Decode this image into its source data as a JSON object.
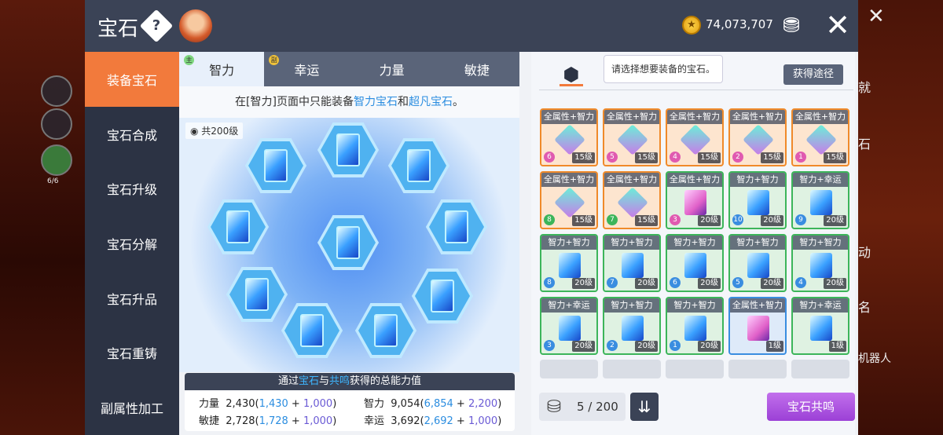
{
  "header": {
    "title": "宝石",
    "help_glyph": "?",
    "currency": "74,073,707"
  },
  "sidebar": {
    "items": [
      "装备宝石",
      "宝石合成",
      "宝石升级",
      "宝石分解",
      "宝石升品",
      "宝石重铸",
      "副属性加工"
    ],
    "active": 0
  },
  "tabs": [
    {
      "label": "智力",
      "badge": "主"
    },
    {
      "label": "幸运",
      "badge": "副"
    },
    {
      "label": "力量",
      "badge": ""
    },
    {
      "label": "敏捷",
      "badge": ""
    }
  ],
  "notice": {
    "pre": "在[智力]页面中只能装备",
    "hl1": "智力宝石",
    "mid": "和",
    "hl2": "超凡宝石",
    "post": "。"
  },
  "stage": {
    "level_total": "共200级"
  },
  "stats": {
    "head_pre": "通过",
    "head_hl1": "宝石",
    "head_mid": "与",
    "head_hl2": "共鸣",
    "head_post": "获得的总能力值",
    "rows": [
      {
        "name": "力量",
        "total": "2,430",
        "a": "1,430",
        "b": "1,000"
      },
      {
        "name": "敏捷",
        "total": "2,728",
        "a": "1,728",
        "b": "1,000"
      },
      {
        "name": "智力",
        "total": "9,054",
        "a": "6,854",
        "b": "2,200"
      },
      {
        "name": "幸运",
        "total": "3,692",
        "a": "2,692",
        "b": "1,000"
      }
    ]
  },
  "right": {
    "tooltip": "请选择想要装备的宝石。",
    "source_button": "获得途径",
    "bag_count": "5 / 200",
    "resonance_button": "宝石共鸣"
  },
  "gems": [
    {
      "label": "全属性+智力",
      "num": "6",
      "level": "15级",
      "frame": "orange",
      "shape": "diamond",
      "num_color": "#e05ab0"
    },
    {
      "label": "全属性+智力",
      "num": "5",
      "level": "15级",
      "frame": "orange",
      "shape": "diamond",
      "num_color": "#e05ab0"
    },
    {
      "label": "全属性+智力",
      "num": "4",
      "level": "15级",
      "frame": "orange",
      "shape": "diamond",
      "num_color": "#e05ab0"
    },
    {
      "label": "全属性+智力",
      "num": "2",
      "level": "15级",
      "frame": "orange",
      "shape": "diamond",
      "num_color": "#e05ab0"
    },
    {
      "label": "全属性+智力",
      "num": "1",
      "level": "15级",
      "frame": "orange",
      "shape": "diamond",
      "num_color": "#e05ab0"
    },
    {
      "label": "全属性+智力",
      "num": "8",
      "level": "15级",
      "frame": "orange",
      "shape": "diamond",
      "num_color": "#3cb55a"
    },
    {
      "label": "全属性+智力",
      "num": "7",
      "level": "15级",
      "frame": "orange",
      "shape": "diamond",
      "num_color": "#3cb55a"
    },
    {
      "label": "全属性+智力",
      "num": "3",
      "level": "20级",
      "frame": "green",
      "shape": "pink",
      "num_color": "#e05ab0"
    },
    {
      "label": "智力+智力",
      "num": "10",
      "level": "20级",
      "frame": "green",
      "shape": "blue",
      "num_color": "#3a8de0"
    },
    {
      "label": "智力+幸运",
      "num": "9",
      "level": "20级",
      "frame": "green",
      "shape": "blue",
      "num_color": "#3a8de0"
    },
    {
      "label": "智力+智力",
      "num": "8",
      "level": "20级",
      "frame": "green",
      "shape": "blue",
      "num_color": "#3a8de0"
    },
    {
      "label": "智力+智力",
      "num": "7",
      "level": "20级",
      "frame": "green",
      "shape": "blue",
      "num_color": "#3a8de0"
    },
    {
      "label": "智力+智力",
      "num": "6",
      "level": "20级",
      "frame": "green",
      "shape": "blue",
      "num_color": "#3a8de0"
    },
    {
      "label": "智力+智力",
      "num": "5",
      "level": "20级",
      "frame": "green",
      "shape": "blue",
      "num_color": "#3a8de0"
    },
    {
      "label": "智力+智力",
      "num": "4",
      "level": "20级",
      "frame": "green",
      "shape": "blue",
      "num_color": "#3a8de0"
    },
    {
      "label": "智力+幸运",
      "num": "3",
      "level": "20级",
      "frame": "green",
      "shape": "blue",
      "num_color": "#3a8de0"
    },
    {
      "label": "智力+智力",
      "num": "2",
      "level": "20级",
      "frame": "green",
      "shape": "blue",
      "num_color": "#3a8de0"
    },
    {
      "label": "智力+智力",
      "num": "1",
      "level": "20级",
      "frame": "green",
      "shape": "blue",
      "num_color": "#3a8de0"
    },
    {
      "label": "全属性+智力",
      "num": "",
      "level": "1级",
      "frame": "blue",
      "shape": "pink",
      "num_color": "#3a8de0"
    },
    {
      "label": "智力+幸运",
      "num": "",
      "level": "1级",
      "frame": "green",
      "shape": "blue",
      "num_color": "#3a8de0"
    }
  ],
  "background": {
    "left_labels": [
      "6/6"
    ],
    "right_labels": [
      "就",
      "石",
      "动",
      "名",
      "机器人"
    ]
  }
}
